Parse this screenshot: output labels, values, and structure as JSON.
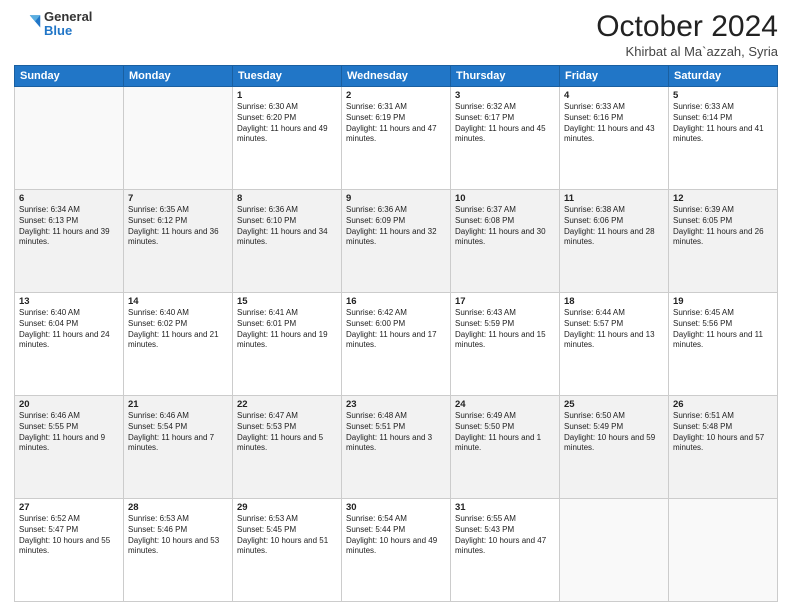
{
  "header": {
    "logo_general": "General",
    "logo_blue": "Blue",
    "month": "October 2024",
    "location": "Khirbat al Ma`azzah, Syria"
  },
  "days_of_week": [
    "Sunday",
    "Monday",
    "Tuesday",
    "Wednesday",
    "Thursday",
    "Friday",
    "Saturday"
  ],
  "weeks": [
    [
      {
        "day": "",
        "sunrise": "",
        "sunset": "",
        "daylight": "",
        "empty": true
      },
      {
        "day": "",
        "sunrise": "",
        "sunset": "",
        "daylight": "",
        "empty": true
      },
      {
        "day": "1",
        "sunrise": "Sunrise: 6:30 AM",
        "sunset": "Sunset: 6:20 PM",
        "daylight": "Daylight: 11 hours and 49 minutes."
      },
      {
        "day": "2",
        "sunrise": "Sunrise: 6:31 AM",
        "sunset": "Sunset: 6:19 PM",
        "daylight": "Daylight: 11 hours and 47 minutes."
      },
      {
        "day": "3",
        "sunrise": "Sunrise: 6:32 AM",
        "sunset": "Sunset: 6:17 PM",
        "daylight": "Daylight: 11 hours and 45 minutes."
      },
      {
        "day": "4",
        "sunrise": "Sunrise: 6:33 AM",
        "sunset": "Sunset: 6:16 PM",
        "daylight": "Daylight: 11 hours and 43 minutes."
      },
      {
        "day": "5",
        "sunrise": "Sunrise: 6:33 AM",
        "sunset": "Sunset: 6:14 PM",
        "daylight": "Daylight: 11 hours and 41 minutes."
      }
    ],
    [
      {
        "day": "6",
        "sunrise": "Sunrise: 6:34 AM",
        "sunset": "Sunset: 6:13 PM",
        "daylight": "Daylight: 11 hours and 39 minutes."
      },
      {
        "day": "7",
        "sunrise": "Sunrise: 6:35 AM",
        "sunset": "Sunset: 6:12 PM",
        "daylight": "Daylight: 11 hours and 36 minutes."
      },
      {
        "day": "8",
        "sunrise": "Sunrise: 6:36 AM",
        "sunset": "Sunset: 6:10 PM",
        "daylight": "Daylight: 11 hours and 34 minutes."
      },
      {
        "day": "9",
        "sunrise": "Sunrise: 6:36 AM",
        "sunset": "Sunset: 6:09 PM",
        "daylight": "Daylight: 11 hours and 32 minutes."
      },
      {
        "day": "10",
        "sunrise": "Sunrise: 6:37 AM",
        "sunset": "Sunset: 6:08 PM",
        "daylight": "Daylight: 11 hours and 30 minutes."
      },
      {
        "day": "11",
        "sunrise": "Sunrise: 6:38 AM",
        "sunset": "Sunset: 6:06 PM",
        "daylight": "Daylight: 11 hours and 28 minutes."
      },
      {
        "day": "12",
        "sunrise": "Sunrise: 6:39 AM",
        "sunset": "Sunset: 6:05 PM",
        "daylight": "Daylight: 11 hours and 26 minutes."
      }
    ],
    [
      {
        "day": "13",
        "sunrise": "Sunrise: 6:40 AM",
        "sunset": "Sunset: 6:04 PM",
        "daylight": "Daylight: 11 hours and 24 minutes."
      },
      {
        "day": "14",
        "sunrise": "Sunrise: 6:40 AM",
        "sunset": "Sunset: 6:02 PM",
        "daylight": "Daylight: 11 hours and 21 minutes."
      },
      {
        "day": "15",
        "sunrise": "Sunrise: 6:41 AM",
        "sunset": "Sunset: 6:01 PM",
        "daylight": "Daylight: 11 hours and 19 minutes."
      },
      {
        "day": "16",
        "sunrise": "Sunrise: 6:42 AM",
        "sunset": "Sunset: 6:00 PM",
        "daylight": "Daylight: 11 hours and 17 minutes."
      },
      {
        "day": "17",
        "sunrise": "Sunrise: 6:43 AM",
        "sunset": "Sunset: 5:59 PM",
        "daylight": "Daylight: 11 hours and 15 minutes."
      },
      {
        "day": "18",
        "sunrise": "Sunrise: 6:44 AM",
        "sunset": "Sunset: 5:57 PM",
        "daylight": "Daylight: 11 hours and 13 minutes."
      },
      {
        "day": "19",
        "sunrise": "Sunrise: 6:45 AM",
        "sunset": "Sunset: 5:56 PM",
        "daylight": "Daylight: 11 hours and 11 minutes."
      }
    ],
    [
      {
        "day": "20",
        "sunrise": "Sunrise: 6:46 AM",
        "sunset": "Sunset: 5:55 PM",
        "daylight": "Daylight: 11 hours and 9 minutes."
      },
      {
        "day": "21",
        "sunrise": "Sunrise: 6:46 AM",
        "sunset": "Sunset: 5:54 PM",
        "daylight": "Daylight: 11 hours and 7 minutes."
      },
      {
        "day": "22",
        "sunrise": "Sunrise: 6:47 AM",
        "sunset": "Sunset: 5:53 PM",
        "daylight": "Daylight: 11 hours and 5 minutes."
      },
      {
        "day": "23",
        "sunrise": "Sunrise: 6:48 AM",
        "sunset": "Sunset: 5:51 PM",
        "daylight": "Daylight: 11 hours and 3 minutes."
      },
      {
        "day": "24",
        "sunrise": "Sunrise: 6:49 AM",
        "sunset": "Sunset: 5:50 PM",
        "daylight": "Daylight: 11 hours and 1 minute."
      },
      {
        "day": "25",
        "sunrise": "Sunrise: 6:50 AM",
        "sunset": "Sunset: 5:49 PM",
        "daylight": "Daylight: 10 hours and 59 minutes."
      },
      {
        "day": "26",
        "sunrise": "Sunrise: 6:51 AM",
        "sunset": "Sunset: 5:48 PM",
        "daylight": "Daylight: 10 hours and 57 minutes."
      }
    ],
    [
      {
        "day": "27",
        "sunrise": "Sunrise: 6:52 AM",
        "sunset": "Sunset: 5:47 PM",
        "daylight": "Daylight: 10 hours and 55 minutes."
      },
      {
        "day": "28",
        "sunrise": "Sunrise: 6:53 AM",
        "sunset": "Sunset: 5:46 PM",
        "daylight": "Daylight: 10 hours and 53 minutes."
      },
      {
        "day": "29",
        "sunrise": "Sunrise: 6:53 AM",
        "sunset": "Sunset: 5:45 PM",
        "daylight": "Daylight: 10 hours and 51 minutes."
      },
      {
        "day": "30",
        "sunrise": "Sunrise: 6:54 AM",
        "sunset": "Sunset: 5:44 PM",
        "daylight": "Daylight: 10 hours and 49 minutes."
      },
      {
        "day": "31",
        "sunrise": "Sunrise: 6:55 AM",
        "sunset": "Sunset: 5:43 PM",
        "daylight": "Daylight: 10 hours and 47 minutes."
      },
      {
        "day": "",
        "sunrise": "",
        "sunset": "",
        "daylight": "",
        "empty": true
      },
      {
        "day": "",
        "sunrise": "",
        "sunset": "",
        "daylight": "",
        "empty": true
      }
    ]
  ]
}
